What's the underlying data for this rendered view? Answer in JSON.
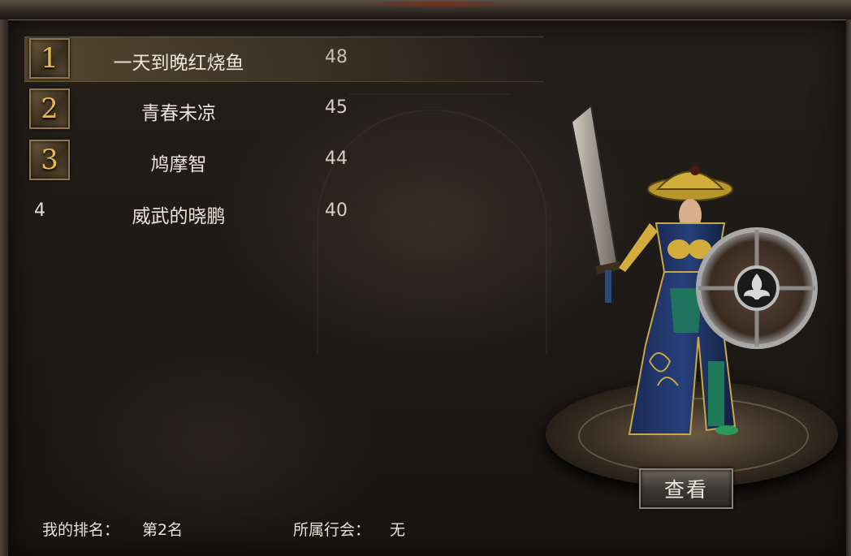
{
  "ranking": [
    {
      "rank": "1",
      "name": "一天到晚红烧鱼",
      "level": "48"
    },
    {
      "rank": "2",
      "name": "青春未凉",
      "level": "45"
    },
    {
      "rank": "3",
      "name": "鸠摩智",
      "level": "44"
    },
    {
      "rank": "4",
      "name": "威武的晓鹏",
      "level": "40"
    }
  ],
  "footer": {
    "my_rank_label": "我的排名：",
    "my_rank_value": "第2名",
    "guild_label": "所属行会：",
    "guild_value": "无"
  },
  "view_button_label": "查看",
  "colors": {
    "gold_numeral": "#e8b94a",
    "text": "#ece6da",
    "highlight_row": "#6e5c3c"
  }
}
